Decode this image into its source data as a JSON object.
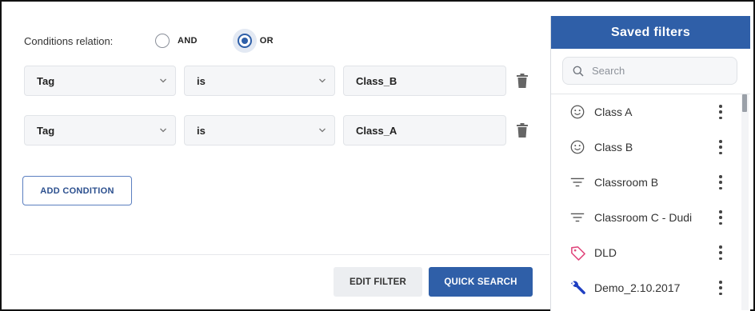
{
  "relation": {
    "label": "Conditions relation:",
    "options": [
      {
        "label": "AND",
        "selected": false
      },
      {
        "label": "OR",
        "selected": true
      }
    ]
  },
  "conditions": [
    {
      "field": "Tag",
      "operator": "is",
      "value": "Class_B"
    },
    {
      "field": "Tag",
      "operator": "is",
      "value": "Class_A"
    }
  ],
  "buttons": {
    "add_condition": "ADD CONDITION",
    "edit_filter": "EDIT FILTER",
    "quick_search": "QUICK SEARCH"
  },
  "saved_filters": {
    "title": "Saved filters",
    "search_placeholder": "Search",
    "items": [
      {
        "label": "Class A",
        "icon": "smiley-icon"
      },
      {
        "label": "Class B",
        "icon": "smiley-icon"
      },
      {
        "label": "Classroom B",
        "icon": "filter-lines-icon"
      },
      {
        "label": "Classroom C - Dudi",
        "icon": "filter-lines-icon"
      },
      {
        "label": "DLD",
        "icon": "tag-icon"
      },
      {
        "label": "Demo_2.10.2017",
        "icon": "wrench-icon"
      }
    ]
  },
  "colors": {
    "primary": "#2f5fa8",
    "tag_icon": "#e0457b",
    "wrench_icon": "#1f3fc2"
  }
}
